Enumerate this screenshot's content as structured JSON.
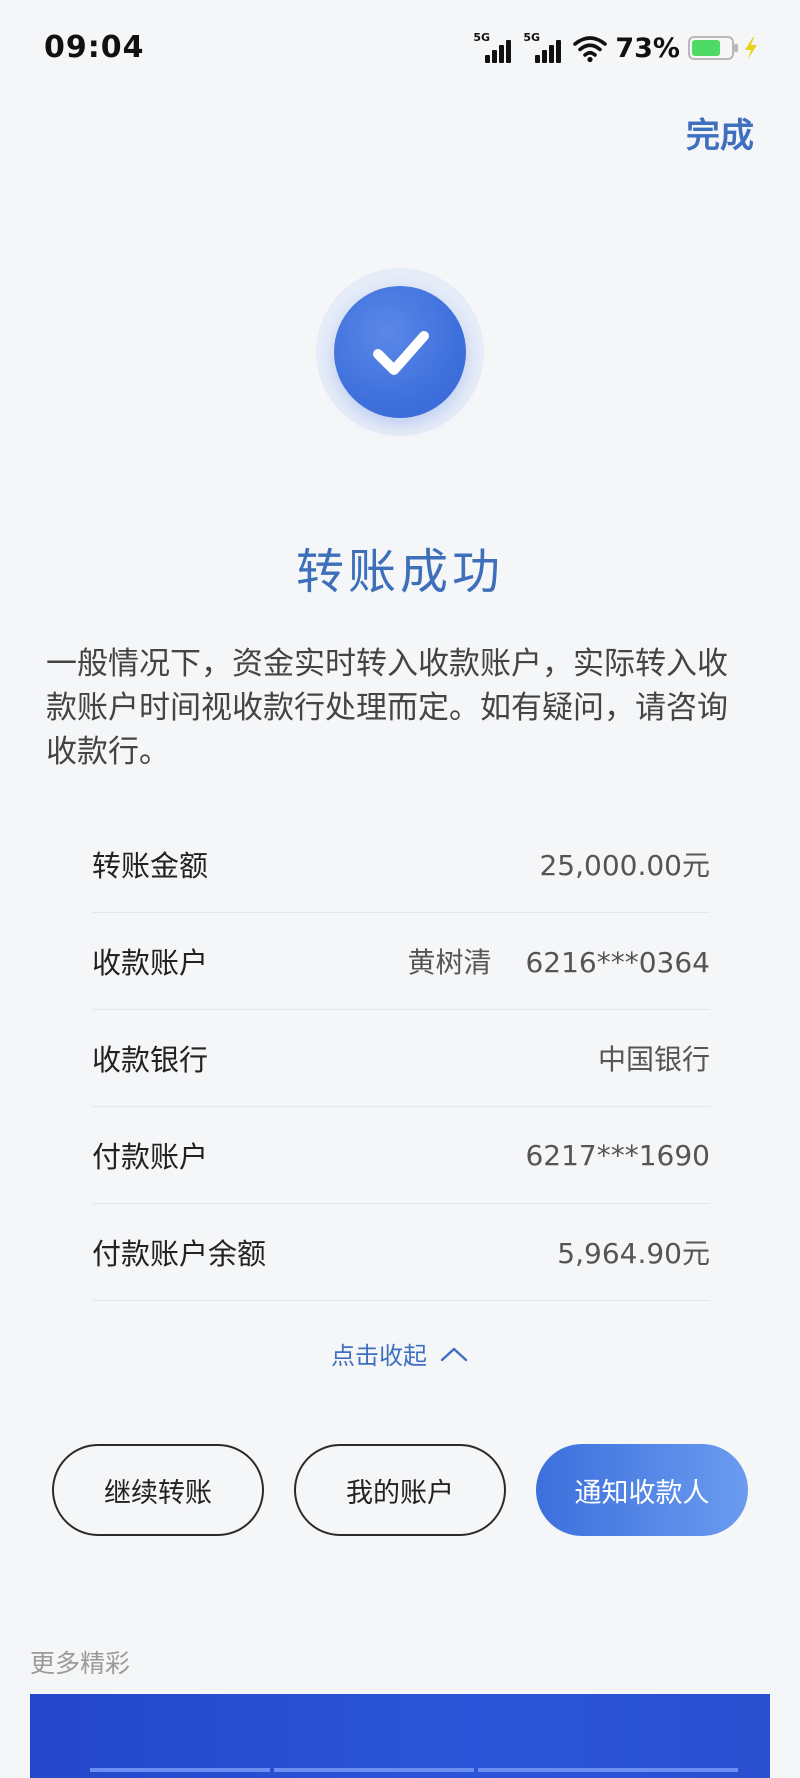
{
  "status_bar": {
    "time": "09:04",
    "signal_labels": [
      "5G",
      "5G"
    ],
    "battery_percent": "73%",
    "battery_level": 0.73,
    "icons": [
      "signal-icon",
      "signal-icon",
      "wifi-icon",
      "battery-icon",
      "charging-bolt-icon"
    ]
  },
  "header": {
    "done_label": "完成"
  },
  "result": {
    "icon": "check-icon",
    "title": "转账成功",
    "note": "一般情况下，资金实时转入收款账户，实际转入收款账户时间视收款行处理而定。如有疑问，请咨询收款行。"
  },
  "details": {
    "amount_label": "转账金额",
    "amount_value": "25,000.00元",
    "payee_label": "收款账户",
    "payee_name": "黄树清",
    "payee_account": "6216***0364",
    "bank_label": "收款银行",
    "bank_value": "中国银行",
    "payer_label": "付款账户",
    "payer_account": "6217***1690",
    "balance_label": "付款账户余额",
    "balance_value": "5,964.90元"
  },
  "collapse": {
    "label": "点击收起",
    "icon": "chevron-up-icon"
  },
  "actions": {
    "continue_label": "继续转账",
    "my_account_label": "我的账户",
    "notify_label": "通知收款人"
  },
  "more": {
    "title": "更多精彩"
  },
  "colors": {
    "accent": "#3f6fbf",
    "primary_button": "#3c6fdc",
    "success_circle": "#3f70dc",
    "battery_fill": "#4cd964",
    "banner": "#2447c9"
  }
}
